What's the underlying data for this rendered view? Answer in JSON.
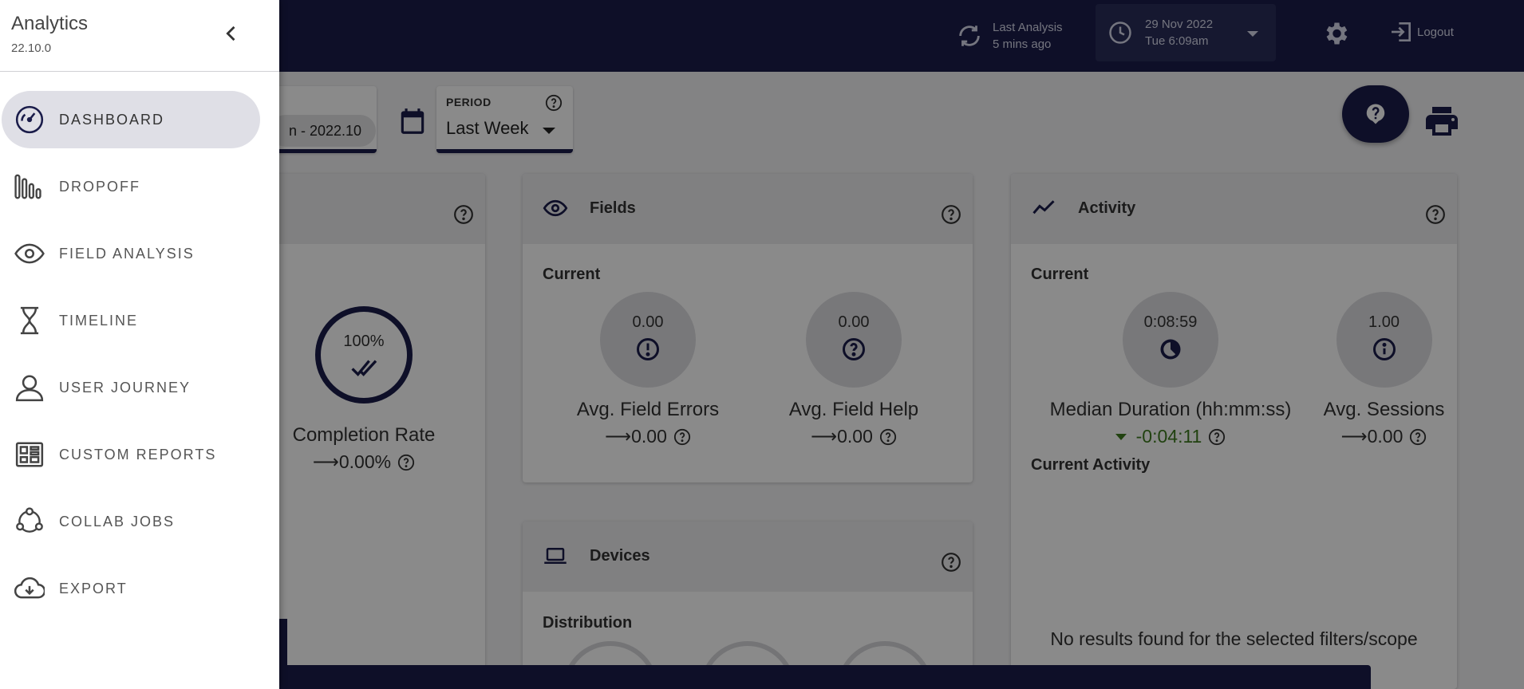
{
  "topbar": {
    "last_analysis_label": "Last Analysis",
    "last_analysis_value": "5 mins ago",
    "date": "29 Nov 2022",
    "day_time": "Tue 6:09am",
    "logout_label": "Logout"
  },
  "filters": {
    "scope_chip": "n - 2022.10",
    "period_label": "PERIOD",
    "period_value": "Last Week"
  },
  "cards": {
    "completion": {
      "ring_value": "100%",
      "label": "Completion Rate",
      "change": "⟶0.00%"
    },
    "fields": {
      "title": "Fields",
      "section": "Current",
      "metrics": [
        {
          "value": "0.00",
          "label": "Avg. Field Errors",
          "change": "⟶0.00"
        },
        {
          "value": "0.00",
          "label": "Avg. Field Help",
          "change": "⟶0.00"
        }
      ]
    },
    "activity": {
      "title": "Activity",
      "section": "Current",
      "metrics": [
        {
          "value": "0:08:59",
          "label": "Median Duration (hh:mm:ss)",
          "change": "-0:04:11"
        },
        {
          "value": "1.00",
          "label": "Avg. Sessions",
          "change": "⟶0.00"
        }
      ],
      "current_activity": "Current Activity",
      "no_results": "No results found for the selected filters/scope"
    },
    "devices": {
      "title": "Devices",
      "section": "Distribution"
    }
  },
  "sidebar": {
    "title": "Analytics",
    "version": "22.10.0",
    "items": [
      {
        "label": "Dashboard",
        "icon": "speedometer-icon",
        "active": true
      },
      {
        "label": "Dropoff",
        "icon": "dropoff-bars-icon"
      },
      {
        "label": "Field Analysis",
        "icon": "eye-icon"
      },
      {
        "label": "Timeline",
        "icon": "hourglass-icon"
      },
      {
        "label": "User Journey",
        "icon": "user-icon"
      },
      {
        "label": "Custom Reports",
        "icon": "report-grid-icon"
      },
      {
        "label": "Collab Jobs",
        "icon": "collab-icon"
      },
      {
        "label": "Export",
        "icon": "cloud-download-icon"
      }
    ]
  },
  "colors": {
    "navy": "#1a1c4a",
    "positive_change": "#3e7a1e"
  }
}
